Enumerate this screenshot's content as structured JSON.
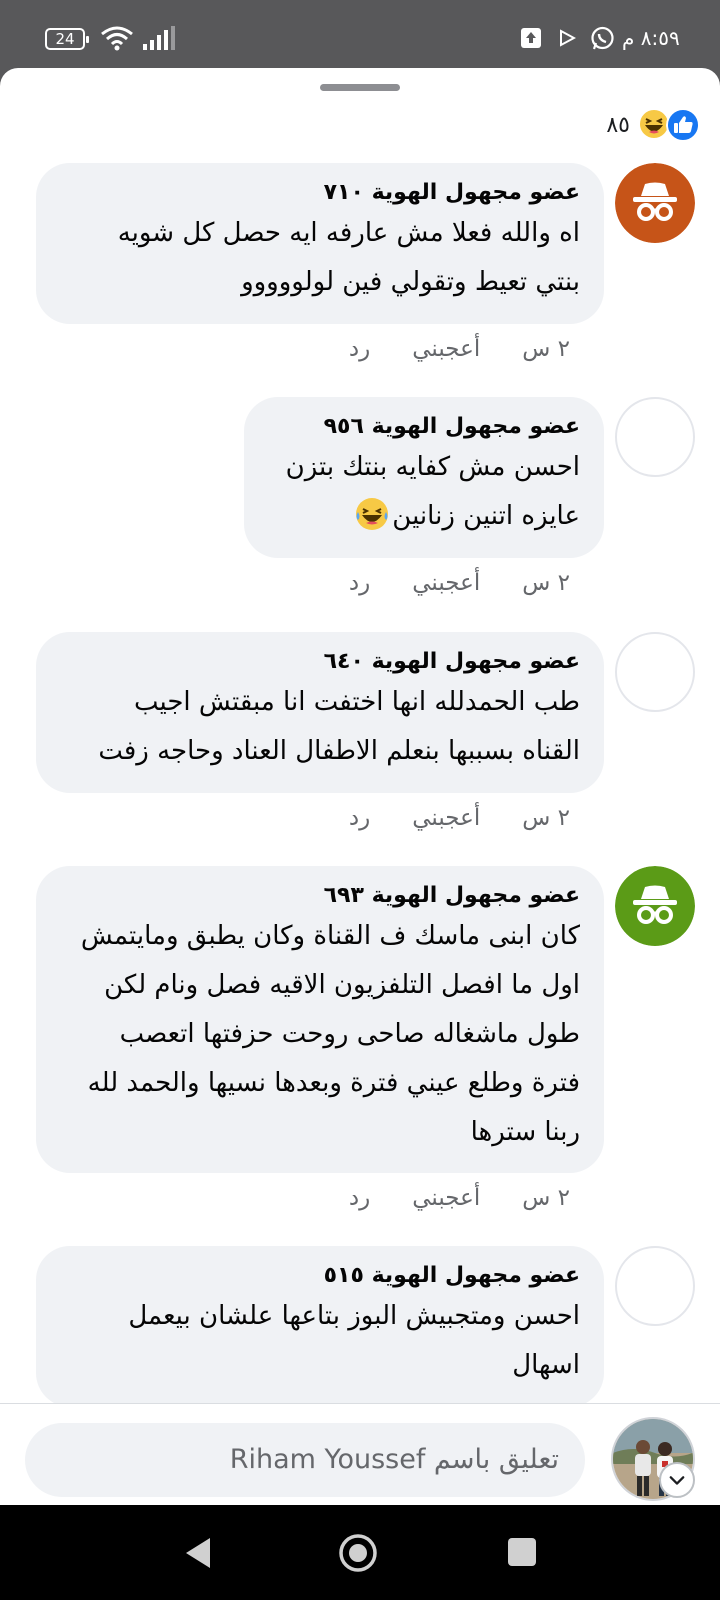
{
  "status_bar": {
    "time": "٨:٥٩ م",
    "battery": "24",
    "icons": [
      "battery-icon",
      "wifi-icon",
      "signal-icon",
      "upload-icon",
      "play-icon",
      "whatsapp-icon"
    ]
  },
  "reactions": {
    "count": "٨٥",
    "types": [
      "like-reaction-icon",
      "haha-reaction-icon"
    ]
  },
  "comments": [
    {
      "author": "عضو مجهول الهوية ٧١٠",
      "lines": [
        "اه والله فعلا مش عارفه ايه حصل كل شويه",
        "بنتي تعيط وتقولي فين لولووووو"
      ],
      "avatar": "anonymous-orange",
      "time": "٢ س",
      "like_label": "أعجبني",
      "reply_label": "رد"
    },
    {
      "author": "عضو مجهول الهوية ٩٥٦",
      "lines": [
        "احسن مش كفايه بنتك بتزن",
        "عايزه اتنين زنانين"
      ],
      "avatar": "none",
      "time": "٢ س",
      "like_label": "أعجبني",
      "reply_label": "رد"
    },
    {
      "author": "عضو مجهول الهوية ٦٤٠",
      "lines": [
        "طب الحمدلله انها اختفت انا مبقتش اجيب",
        "القناه بسببها بنعلم الاطفال العناد وحاجه زفت"
      ],
      "avatar": "none",
      "time": "٢ س",
      "like_label": "أعجبني",
      "reply_label": "رد"
    },
    {
      "author": "عضو مجهول الهوية ٦٩٣",
      "lines": [
        "كان ابنى ماسك ف القناة وكان يطبق ومايتمش",
        "اول ما افصل التلفزيون الاقيه فصل ونام لكن",
        "طول ماشغاله صاحى روحت حزفتها اتعصب",
        "فترة وطلع عيني فترة وبعدها نسيها والحمد لله",
        "ربنا سترها"
      ],
      "avatar": "anonymous-green",
      "time": "٢ س",
      "like_label": "أعجبني",
      "reply_label": "رد"
    },
    {
      "author": "عضو مجهول الهوية ٥١٥",
      "lines": [
        "احسن ومتجبيش البوز بتاعها علشان بيعمل",
        "اسهال"
      ],
      "avatar": "none"
    }
  ],
  "composer": {
    "placeholder": "تعليق باسم Riham Youssef"
  },
  "nav_bar": {
    "buttons": [
      "back-icon",
      "home-icon",
      "recent-apps-icon"
    ]
  },
  "colors": {
    "status_bar": "#58585a",
    "bubble": "#f0f2f5",
    "meta_text": "#65676b",
    "like_blue": "#1877f2",
    "avatar_orange": "#c65418",
    "avatar_green": "#5b9b17"
  }
}
